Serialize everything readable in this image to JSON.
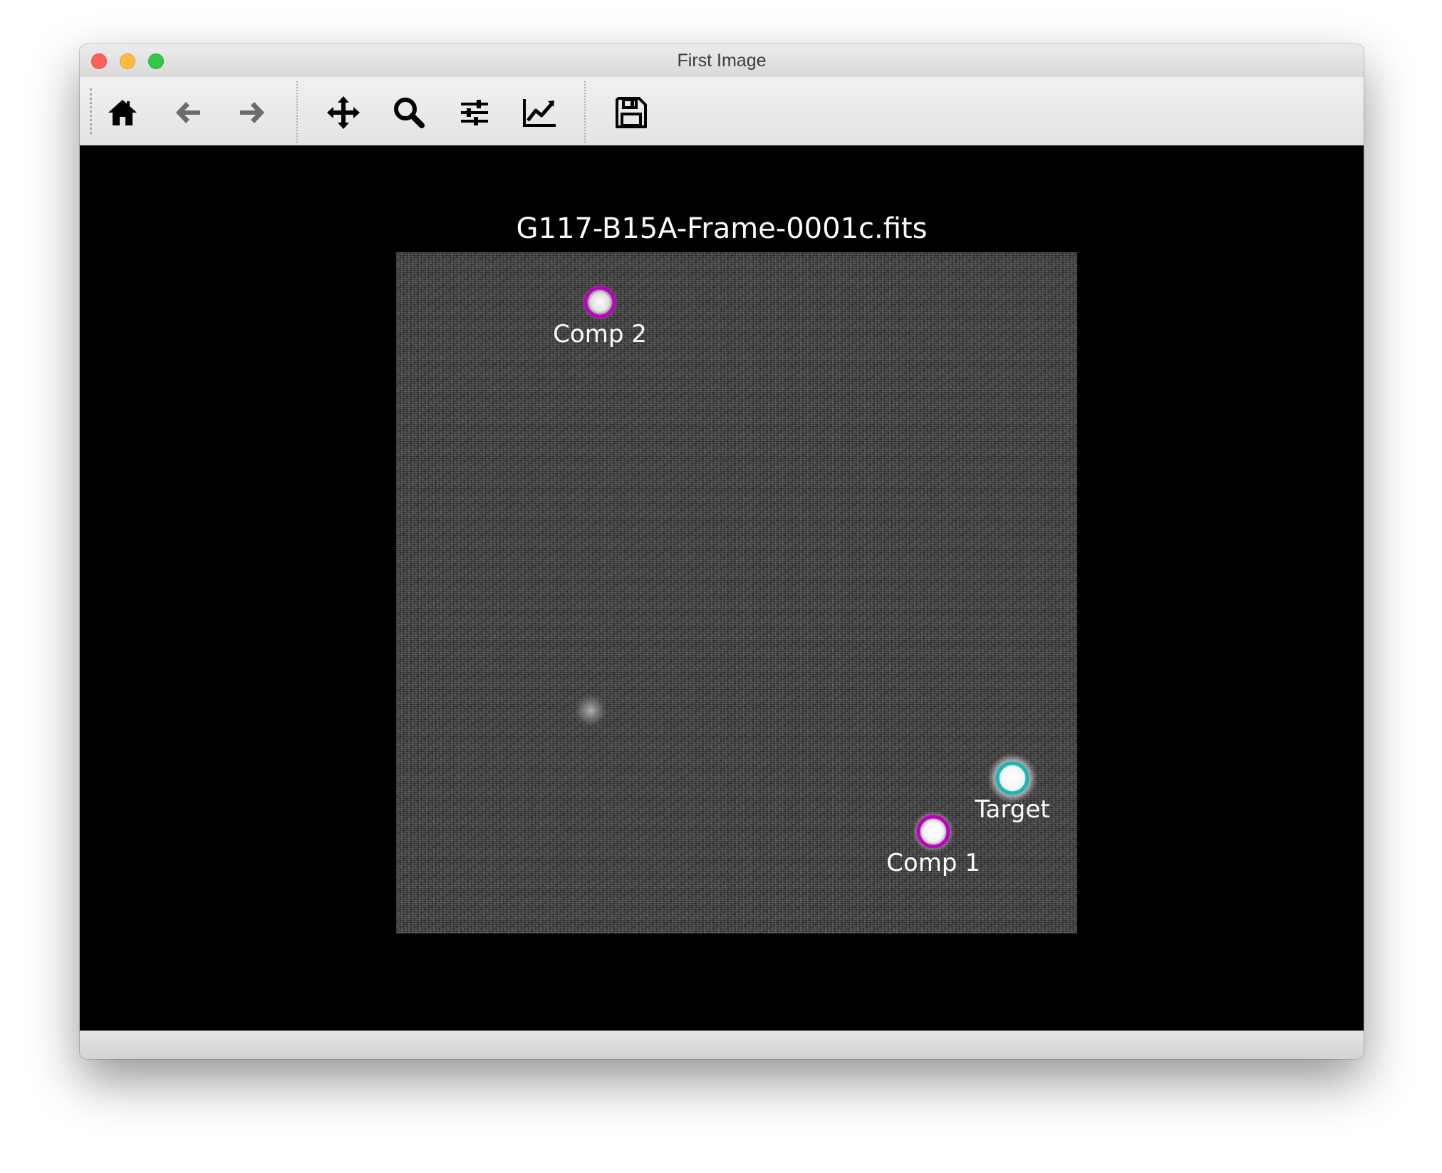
{
  "window": {
    "title": "First Image"
  },
  "toolbar": {
    "buttons": [
      {
        "name": "home",
        "icon": "home-icon"
      },
      {
        "name": "back",
        "icon": "arrow-left-icon"
      },
      {
        "name": "forward",
        "icon": "arrow-right-icon"
      },
      {
        "name": "pan",
        "icon": "move-arrows-icon"
      },
      {
        "name": "zoom",
        "icon": "magnifier-icon"
      },
      {
        "name": "configure-subplots",
        "icon": "sliders-icon"
      },
      {
        "name": "edit-axis",
        "icon": "line-chart-icon"
      },
      {
        "name": "save",
        "icon": "floppy-disk-icon"
      }
    ]
  },
  "plot": {
    "title": "G117-B15A-Frame-0001c.fits",
    "background_color": "#000000",
    "stars": [
      {
        "label": "Comp 2",
        "marker_color": "#c000c0"
      },
      {
        "label": "Target",
        "marker_color": "#10b8b8"
      },
      {
        "label": "Comp 1",
        "marker_color": "#c000c0"
      }
    ]
  }
}
